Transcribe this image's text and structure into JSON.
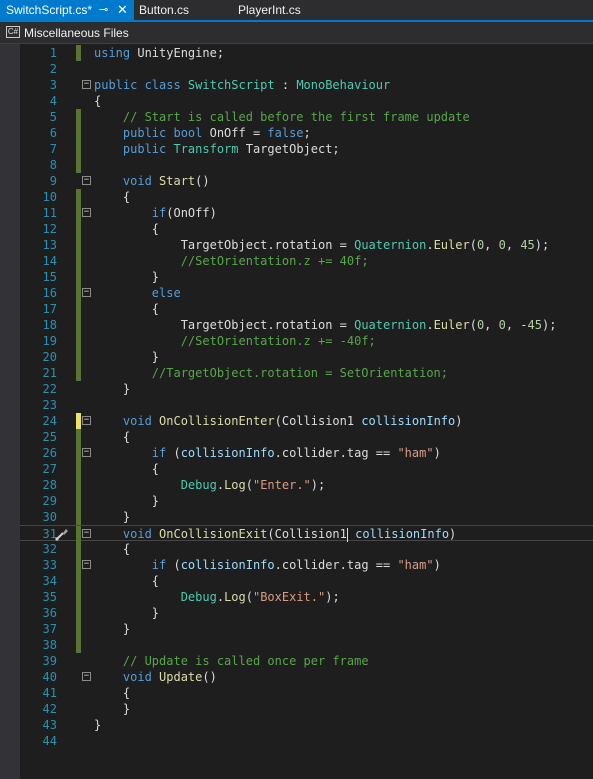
{
  "tabs": [
    {
      "label": "SwitchScript.cs*",
      "pin": "⊸",
      "close": "✕"
    },
    {
      "label": "Button.cs"
    },
    {
      "label": "PlayerInt.cs"
    }
  ],
  "file_dropdown": {
    "icon_text": "C#",
    "label": "Miscellaneous Files"
  },
  "editor": {
    "lines": [
      {
        "n": "1",
        "tokens": [
          [
            "kw",
            "using"
          ],
          [
            "pl",
            " UnityEngine;"
          ]
        ]
      },
      {
        "n": "2",
        "tokens": []
      },
      {
        "n": "3",
        "tokens": [
          [
            "kw",
            "public class "
          ],
          [
            "ty",
            "SwitchScript"
          ],
          [
            "pl",
            " : "
          ],
          [
            "ty",
            "MonoBehaviour"
          ]
        ]
      },
      {
        "n": "4",
        "tokens": [
          [
            "pl",
            "{"
          ]
        ]
      },
      {
        "n": "5",
        "tokens": [
          [
            "pl",
            "    "
          ],
          [
            "cm",
            "// Start is called before the first frame update"
          ]
        ]
      },
      {
        "n": "6",
        "tokens": [
          [
            "pl",
            "    "
          ],
          [
            "kw",
            "public bool "
          ],
          [
            "pl",
            "OnOff = "
          ],
          [
            "kw",
            "false"
          ],
          [
            "pl",
            ";"
          ]
        ]
      },
      {
        "n": "7",
        "tokens": [
          [
            "pl",
            "    "
          ],
          [
            "kw",
            "public "
          ],
          [
            "ty",
            "Transform"
          ],
          [
            "pl",
            " TargetObject;"
          ]
        ]
      },
      {
        "n": "8",
        "tokens": []
      },
      {
        "n": "9",
        "tokens": [
          [
            "pl",
            "    "
          ],
          [
            "kw",
            "void "
          ],
          [
            "fn",
            "Start"
          ],
          [
            "pl",
            "()"
          ]
        ]
      },
      {
        "n": "10",
        "tokens": [
          [
            "pl",
            "    {"
          ]
        ]
      },
      {
        "n": "11",
        "tokens": [
          [
            "pl",
            "        "
          ],
          [
            "kw",
            "if"
          ],
          [
            "pl",
            "(OnOff)"
          ]
        ]
      },
      {
        "n": "12",
        "tokens": [
          [
            "pl",
            "        {"
          ]
        ]
      },
      {
        "n": "13",
        "tokens": [
          [
            "pl",
            "            TargetObject.rotation = "
          ],
          [
            "ty",
            "Quaternion"
          ],
          [
            "pl",
            "."
          ],
          [
            "fn",
            "Euler"
          ],
          [
            "pl",
            "("
          ],
          [
            "nu",
            "0"
          ],
          [
            "pl",
            ", "
          ],
          [
            "nu",
            "0"
          ],
          [
            "pl",
            ", "
          ],
          [
            "nu",
            "45"
          ],
          [
            "pl",
            ");"
          ]
        ]
      },
      {
        "n": "14",
        "tokens": [
          [
            "pl",
            "            "
          ],
          [
            "cm",
            "//SetOrientation.z += 40f;"
          ]
        ]
      },
      {
        "n": "15",
        "tokens": [
          [
            "pl",
            "        }"
          ]
        ]
      },
      {
        "n": "16",
        "tokens": [
          [
            "pl",
            "        "
          ],
          [
            "kw",
            "else"
          ]
        ]
      },
      {
        "n": "17",
        "tokens": [
          [
            "pl",
            "        {"
          ]
        ]
      },
      {
        "n": "18",
        "tokens": [
          [
            "pl",
            "            TargetObject.rotation = "
          ],
          [
            "ty",
            "Quaternion"
          ],
          [
            "pl",
            "."
          ],
          [
            "fn",
            "Euler"
          ],
          [
            "pl",
            "("
          ],
          [
            "nu",
            "0"
          ],
          [
            "pl",
            ", "
          ],
          [
            "nu",
            "0"
          ],
          [
            "pl",
            ", -"
          ],
          [
            "nu",
            "45"
          ],
          [
            "pl",
            ");"
          ]
        ]
      },
      {
        "n": "19",
        "tokens": [
          [
            "pl",
            "            "
          ],
          [
            "cm",
            "//SetOrientation.z += -40f;"
          ]
        ]
      },
      {
        "n": "20",
        "tokens": [
          [
            "pl",
            "        }"
          ]
        ]
      },
      {
        "n": "21",
        "tokens": [
          [
            "pl",
            "        "
          ],
          [
            "cm",
            "//TargetObject.rotation = SetOrientation;"
          ]
        ]
      },
      {
        "n": "22",
        "tokens": [
          [
            "pl",
            "    }"
          ]
        ]
      },
      {
        "n": "23",
        "tokens": []
      },
      {
        "n": "24",
        "tokens": [
          [
            "pl",
            "    "
          ],
          [
            "kw",
            "void "
          ],
          [
            "fn",
            "OnCollisionEnter"
          ],
          [
            "pl",
            "(Collision1 "
          ],
          [
            "pr",
            "collisionInfo"
          ],
          [
            "pl",
            ")"
          ]
        ]
      },
      {
        "n": "25",
        "tokens": [
          [
            "pl",
            "    {"
          ]
        ]
      },
      {
        "n": "26",
        "tokens": [
          [
            "pl",
            "        "
          ],
          [
            "kw",
            "if"
          ],
          [
            "pl",
            " ("
          ],
          [
            "pr",
            "collisionInfo"
          ],
          [
            "pl",
            ".collider.tag == "
          ],
          [
            "st",
            "\"ham\""
          ],
          [
            "pl",
            ")"
          ]
        ]
      },
      {
        "n": "27",
        "tokens": [
          [
            "pl",
            "        {"
          ]
        ]
      },
      {
        "n": "28",
        "tokens": [
          [
            "pl",
            "            "
          ],
          [
            "ty",
            "Debug"
          ],
          [
            "pl",
            "."
          ],
          [
            "fn",
            "Log"
          ],
          [
            "pl",
            "("
          ],
          [
            "st",
            "\"Enter.\""
          ],
          [
            "pl",
            ");"
          ]
        ]
      },
      {
        "n": "29",
        "tokens": [
          [
            "pl",
            "        }"
          ]
        ]
      },
      {
        "n": "30",
        "tokens": [
          [
            "pl",
            "    }"
          ]
        ]
      },
      {
        "n": "31",
        "tokens": [
          [
            "pl",
            "    "
          ],
          [
            "kw",
            "void "
          ],
          [
            "fn",
            "OnCollisionExit"
          ],
          [
            "pl",
            "(Collision1"
          ],
          [
            "caret",
            ""
          ],
          [
            "pl",
            " "
          ],
          [
            "pr",
            "collisionInfo"
          ],
          [
            "pl",
            ")"
          ]
        ]
      },
      {
        "n": "32",
        "tokens": [
          [
            "pl",
            "    {"
          ]
        ]
      },
      {
        "n": "33",
        "tokens": [
          [
            "pl",
            "        "
          ],
          [
            "kw",
            "if"
          ],
          [
            "pl",
            " ("
          ],
          [
            "pr",
            "collisionInfo"
          ],
          [
            "pl",
            ".collider.tag == "
          ],
          [
            "st",
            "\"ham\""
          ],
          [
            "pl",
            ")"
          ]
        ]
      },
      {
        "n": "34",
        "tokens": [
          [
            "pl",
            "        {"
          ]
        ]
      },
      {
        "n": "35",
        "tokens": [
          [
            "pl",
            "            "
          ],
          [
            "ty",
            "Debug"
          ],
          [
            "pl",
            "."
          ],
          [
            "fn",
            "Log"
          ],
          [
            "pl",
            "("
          ],
          [
            "st",
            "\"BoxExit.\""
          ],
          [
            "pl",
            ");"
          ]
        ]
      },
      {
        "n": "36",
        "tokens": [
          [
            "pl",
            "        }"
          ]
        ]
      },
      {
        "n": "37",
        "tokens": [
          [
            "pl",
            "    }"
          ]
        ]
      },
      {
        "n": "38",
        "tokens": []
      },
      {
        "n": "39",
        "tokens": [
          [
            "pl",
            "    "
          ],
          [
            "cm",
            "// Update is called once per frame"
          ]
        ]
      },
      {
        "n": "40",
        "tokens": [
          [
            "pl",
            "    "
          ],
          [
            "kw",
            "void "
          ],
          [
            "fn",
            "Update"
          ],
          [
            "pl",
            "()"
          ]
        ]
      },
      {
        "n": "41",
        "tokens": [
          [
            "pl",
            "    {"
          ]
        ]
      },
      {
        "n": "42",
        "tokens": [
          [
            "pl",
            "    }"
          ]
        ]
      },
      {
        "n": "43",
        "tokens": [
          [
            "pl",
            "}"
          ]
        ]
      },
      {
        "n": "44",
        "tokens": []
      }
    ],
    "folds": [
      "3",
      "9",
      "11",
      "16",
      "24",
      "26",
      "31",
      "33",
      "40"
    ],
    "changes": {
      "5": "saved",
      "6": "saved",
      "7": "saved",
      "8": "saved",
      "10": "saved",
      "11": "saved",
      "12": "saved",
      "13": "saved",
      "14": "saved",
      "15": "saved",
      "16": "saved",
      "17": "saved",
      "18": "saved",
      "19": "saved",
      "20": "saved",
      "21": "saved",
      "24": "unsaved",
      "25": "saved",
      "26": "saved",
      "27": "saved",
      "28": "saved",
      "29": "saved",
      "30": "saved",
      "31": "saved",
      "32": "saved",
      "33": "saved",
      "34": "saved",
      "35": "saved",
      "36": "saved",
      "37": "saved",
      "38": "saved",
      "1": "saved"
    },
    "caret_line": "31",
    "quick_action_line": "31",
    "quick_action_icon": "paintbrush-icon",
    "colors": {
      "keyword": "#569cd6",
      "type": "#4ec9b0",
      "method": "#dcdcaa",
      "parameter": "#9cdcfe",
      "string": "#d69d85",
      "number": "#b5cea8",
      "comment": "#57a64a",
      "line_number": "#2b91af",
      "accent": "#007acc",
      "background": "#1e1e1e"
    }
  }
}
